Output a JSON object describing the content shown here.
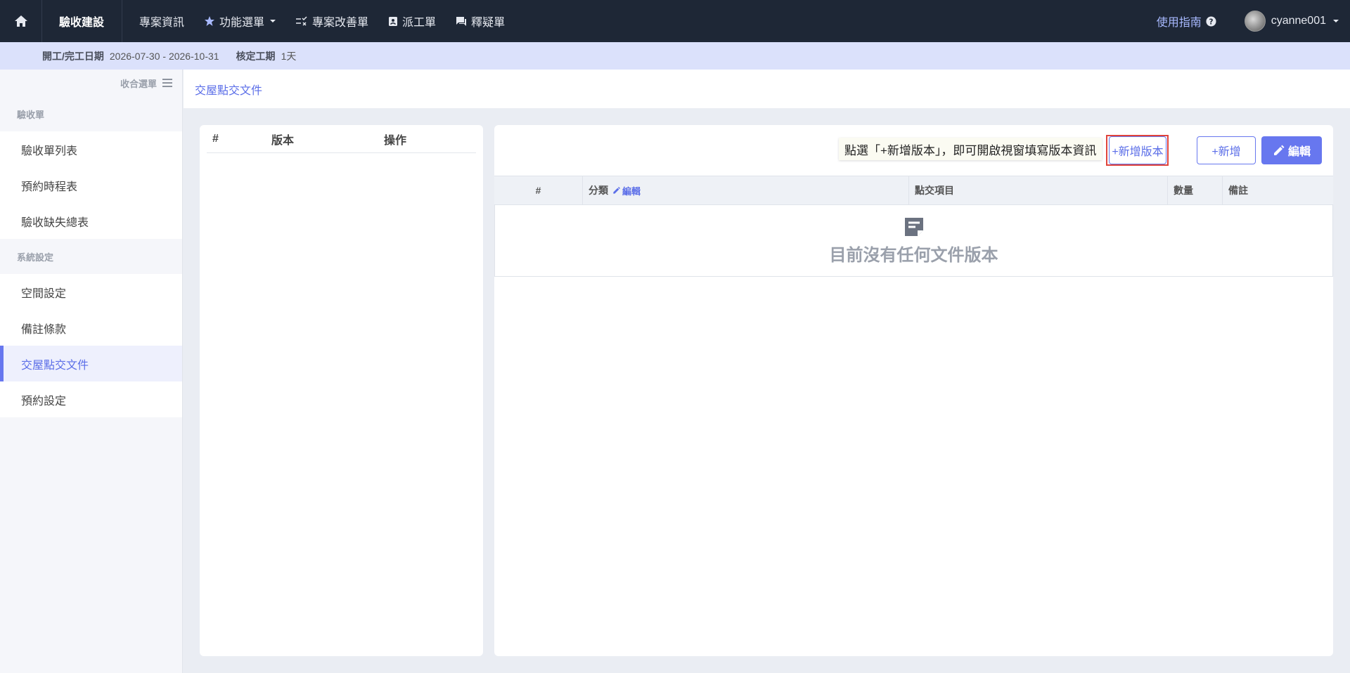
{
  "topbar": {
    "brand": "驗收建設",
    "nav": [
      {
        "label": "專案資訊",
        "icon": ""
      },
      {
        "label": "功能選單",
        "icon": "star-icon",
        "dropdown": true
      },
      {
        "label": "專案改善單",
        "icon": "checklist-icon"
      },
      {
        "label": "派工單",
        "icon": "badge-icon"
      },
      {
        "label": "釋疑單",
        "icon": "chat-icon"
      }
    ],
    "guide_label": "使用指南",
    "username": "cyanne001"
  },
  "infobar": {
    "period_label": "開工/完工日期",
    "period_value": "2026-07-30 - 2026-10-31",
    "duration_label": "核定工期",
    "duration_value": "1天"
  },
  "sidebar": {
    "collapse_label": "收合選單",
    "groups": [
      {
        "title": "驗收單",
        "items": [
          "驗收單列表",
          "預約時程表",
          "驗收缺失總表"
        ]
      },
      {
        "title": "系統設定",
        "items": [
          "空間設定",
          "備註條款",
          "交屋點交文件",
          "預約設定"
        ]
      }
    ],
    "active_item": "交屋點交文件"
  },
  "breadcrumb": "交屋點交文件",
  "version_table": {
    "columns": [
      "#",
      "版本",
      "操作"
    ]
  },
  "toolbar": {
    "tooltip": "點選「+新增版本」，即可開啟視窗填寫版本資訊",
    "add_version_label": "+新增版本",
    "add_label": "+新增",
    "edit_label": "編輯"
  },
  "doc_table": {
    "columns": [
      "#",
      "分類",
      "點交項目",
      "數量",
      "備註"
    ],
    "category_edit_label": "編輯",
    "empty_text": "目前沒有任何文件版本"
  },
  "colors": {
    "topbar": "#1e2736",
    "accent": "#6777ef",
    "infobar": "#dbe1fb",
    "highlight": "#e0443c"
  }
}
